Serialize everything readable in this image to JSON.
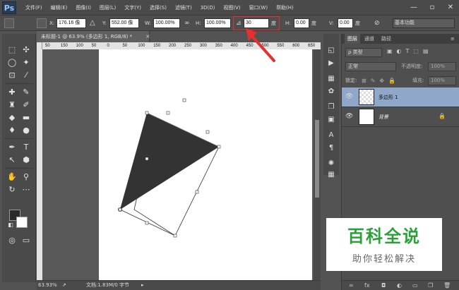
{
  "app": {
    "logo": "Ps"
  },
  "menu": [
    "文件(F)",
    "编辑(E)",
    "图像(I)",
    "图层(L)",
    "文字(Y)",
    "选择(S)",
    "滤镜(T)",
    "3D(D)",
    "视图(V)",
    "窗口(W)",
    "帮助(H)"
  ],
  "window_controls": {
    "minimize": "—",
    "maximize": "▫",
    "close": "✕"
  },
  "options": {
    "x_label": "X:",
    "x_value": "176.16 像",
    "y_label": "Y:",
    "y_value": "552.00 像",
    "w_label": "W:",
    "w_value": "100.00%",
    "h_label": "H:",
    "h_value": "100.00%",
    "angle_value": "30",
    "angle_unit": "度",
    "hskew_label": "H:",
    "hskew_value": "0.00",
    "hskew_unit": "度",
    "vskew_label": "V:",
    "vskew_value": "0.00",
    "vskew_unit": "度",
    "workspace": "基本功能"
  },
  "document": {
    "tab_title": "未标题-1 @ 63.9% (多边形 1, RGB/8) *",
    "tab_close": "×",
    "ruler_ticks": [
      "50",
      "150",
      "100",
      "50",
      "0",
      "50",
      "100",
      "150",
      "200",
      "250",
      "300",
      "350",
      "400",
      "450",
      "500",
      "550",
      "600",
      "650"
    ]
  },
  "status": {
    "zoom": "63.93%",
    "doc_info": "文档:1.83M/0 字节"
  },
  "layers_panel": {
    "tabs": [
      "图层",
      "通道",
      "路径"
    ],
    "filter_label": "ρ 类型",
    "blend_mode": "正常",
    "opacity_label": "不透明度:",
    "opacity_value": "100%",
    "lock_label": "锁定:",
    "fill_label": "填充:",
    "fill_value": "100%",
    "layers": [
      {
        "name": "多边形 1",
        "selected": true
      },
      {
        "name": "背景",
        "selected": false
      }
    ]
  },
  "watermark": {
    "title": "百科全说",
    "subtitle": "助你轻松解决"
  },
  "colors": {
    "accent_red": "#e53030",
    "shape_fill": "#333333",
    "watermark_green": "#2aa138"
  }
}
